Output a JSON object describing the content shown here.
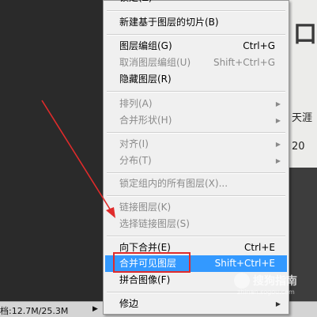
{
  "canvas": {
    "glyph": "口",
    "line1": "天涯",
    "line2": "20"
  },
  "status_bar": {
    "doc_size": "档:12.7M/25.3M",
    "arrow": "▶"
  },
  "menu": {
    "top_cut_label": "锁定(Z)",
    "items": [
      {
        "label": "新建基于图层的切片(B)",
        "shortcut": "",
        "disabled": false,
        "submenu": false
      },
      {
        "label": "图层编组(G)",
        "shortcut": "Ctrl+G",
        "disabled": false,
        "submenu": false
      },
      {
        "label": "取消图层编组(U)",
        "shortcut": "Shift+Ctrl+G",
        "disabled": true,
        "submenu": false
      },
      {
        "label": "隐藏图层(R)",
        "shortcut": "",
        "disabled": false,
        "submenu": false
      },
      {
        "label": "排列(A)",
        "shortcut": "",
        "disabled": true,
        "submenu": true
      },
      {
        "label": "合并形状(H)",
        "shortcut": "",
        "disabled": true,
        "submenu": true
      },
      {
        "label": "对齐(I)",
        "shortcut": "",
        "disabled": true,
        "submenu": true
      },
      {
        "label": "分布(T)",
        "shortcut": "",
        "disabled": true,
        "submenu": true
      },
      {
        "label": "锁定组内的所有图层(X)...",
        "shortcut": "",
        "disabled": true,
        "submenu": false
      },
      {
        "label": "链接图层(K)",
        "shortcut": "",
        "disabled": true,
        "submenu": false
      },
      {
        "label": "选择链接图层(S)",
        "shortcut": "",
        "disabled": true,
        "submenu": false
      },
      {
        "label": "向下合并(E)",
        "shortcut": "Ctrl+E",
        "disabled": false,
        "submenu": false
      },
      {
        "label": "合并可见图层",
        "shortcut": "Shift+Ctrl+E",
        "disabled": false,
        "submenu": false,
        "selected": true
      },
      {
        "label": "拼合图像(F)",
        "shortcut": "",
        "disabled": false,
        "submenu": false
      },
      {
        "label": "修边",
        "shortcut": "",
        "disabled": false,
        "submenu": true
      }
    ],
    "submenu_arrow": "▶"
  },
  "annotation": {
    "arrow_color": "#e02b2b",
    "highlight_color": "#e02b2b"
  },
  "watermark": {
    "name": "搜狗指南",
    "url": "zhinan.sogou.com"
  }
}
